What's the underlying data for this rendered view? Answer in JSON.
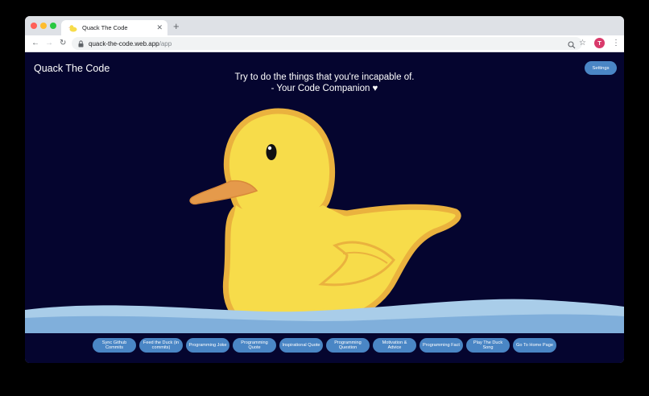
{
  "browser": {
    "tab_title": "Quack The Code",
    "url_host": "quack-the-code.web.app",
    "url_path": "/app",
    "avatar_initial": "T",
    "favicon": "duck-icon"
  },
  "app": {
    "title": "Quack The Code",
    "settings_label": "Settings",
    "quote_line1": "Try to do the things that you're incapable of.",
    "quote_line2": "- Your Code Companion ♥",
    "actions": [
      "Sync Github Commits",
      "Feed the Duck (in commits)",
      "Programming Joke",
      "Programming Quote",
      "Inspirational Quote",
      "Programming Question",
      "Motivation & Advice",
      "Programming Fact",
      "Play The Duck Song",
      "Go To Home Page"
    ]
  },
  "colors": {
    "background": "#05052f",
    "button": "#4a86c5",
    "duck_body": "#f7dc4a",
    "duck_outline": "#eab23e",
    "beak": "#e59a4b",
    "water": "#a9cde9"
  }
}
